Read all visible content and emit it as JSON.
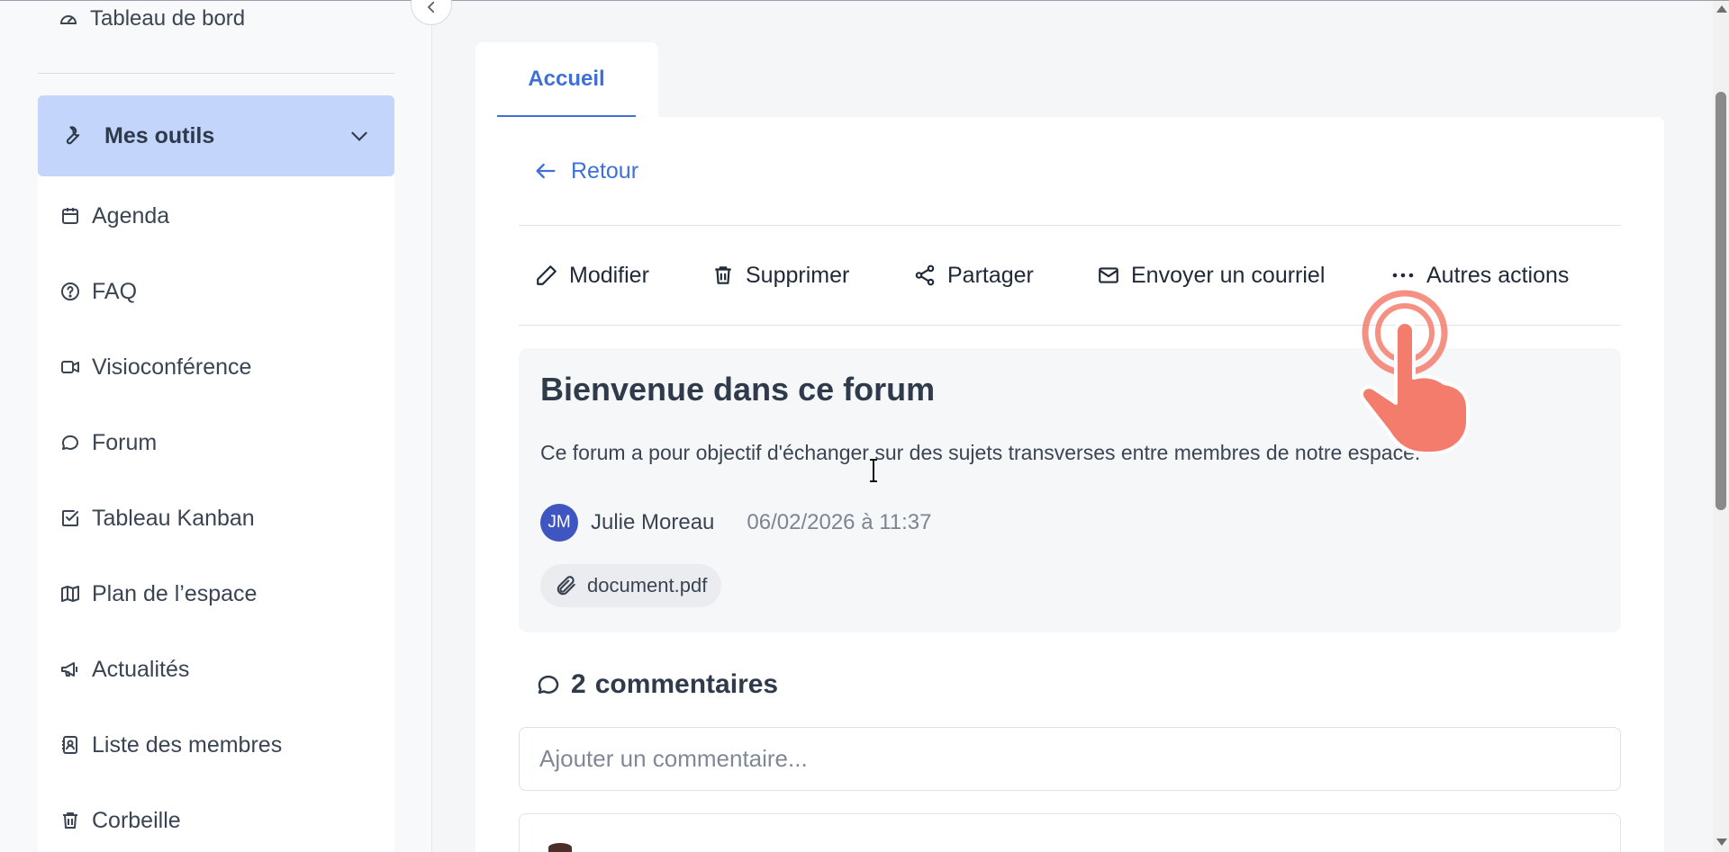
{
  "sidebar": {
    "dashboard_label": "Tableau de bord",
    "group_label": "Mes outils",
    "items": [
      {
        "label": "Agenda",
        "icon": "calendar-icon"
      },
      {
        "label": "FAQ",
        "icon": "question-icon"
      },
      {
        "label": "Visioconférence",
        "icon": "video-icon"
      },
      {
        "label": "Forum",
        "icon": "chat-icon"
      },
      {
        "label": "Tableau Kanban",
        "icon": "check-square-icon"
      },
      {
        "label": "Plan de l’espace",
        "icon": "map-icon"
      },
      {
        "label": "Actualités",
        "icon": "megaphone-icon"
      },
      {
        "label": "Liste des membres",
        "icon": "contacts-icon"
      },
      {
        "label": "Corbeille",
        "icon": "trash-icon"
      }
    ]
  },
  "tabs": [
    {
      "label": "Accueil"
    }
  ],
  "nav": {
    "back_label": "Retour"
  },
  "actions": {
    "edit": "Modifier",
    "delete": "Supprimer",
    "share": "Partager",
    "email": "Envoyer un courriel",
    "more": "Autres actions"
  },
  "post": {
    "title": "Bienvenue dans ce forum",
    "body": "Ce forum a pour objectif d'échanger sur des sujets transverses entre membres de notre espace.",
    "author_initials": "JM",
    "author_name": "Julie Moreau",
    "date": "06/02/2026 à 11:37",
    "attachment": "document.pdf"
  },
  "comments": {
    "count": "2",
    "label": "commentaires",
    "input_placeholder": "Ajouter un commentaire..."
  },
  "colors": {
    "accent": "#3f6fd8",
    "active_group_bg": "#c4d5fb",
    "avatar_bg": "#3e55c2",
    "click_indicator": "#f47c6c"
  }
}
